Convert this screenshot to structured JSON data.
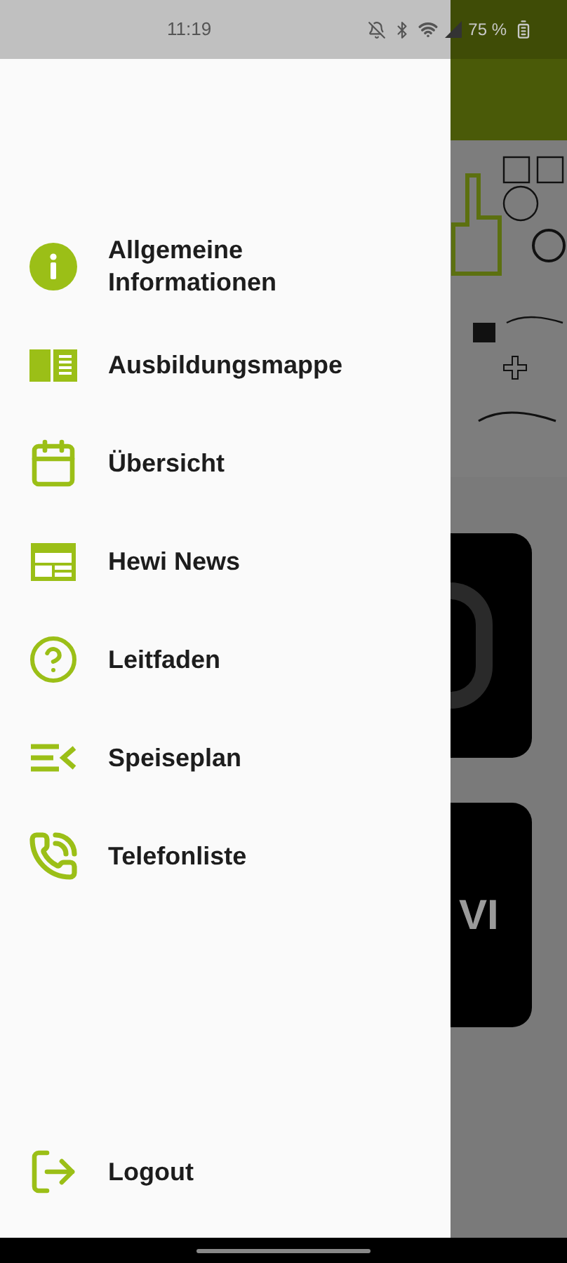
{
  "status_bar": {
    "time": "11:19",
    "battery": "75 %"
  },
  "menu": [
    {
      "kind": "info",
      "label": "Allgemeine Informationen"
    },
    {
      "kind": "book",
      "label": "Ausbildungsmappe"
    },
    {
      "kind": "calendar",
      "label": "Übersicht"
    },
    {
      "kind": "news",
      "label": "Hewi News"
    },
    {
      "kind": "help",
      "label": "Leitfaden"
    },
    {
      "kind": "list",
      "label": "Speiseplan"
    },
    {
      "kind": "phone",
      "label": "Telefonliste"
    }
  ],
  "logout": {
    "label": "Logout"
  },
  "background_card_text": "VI"
}
